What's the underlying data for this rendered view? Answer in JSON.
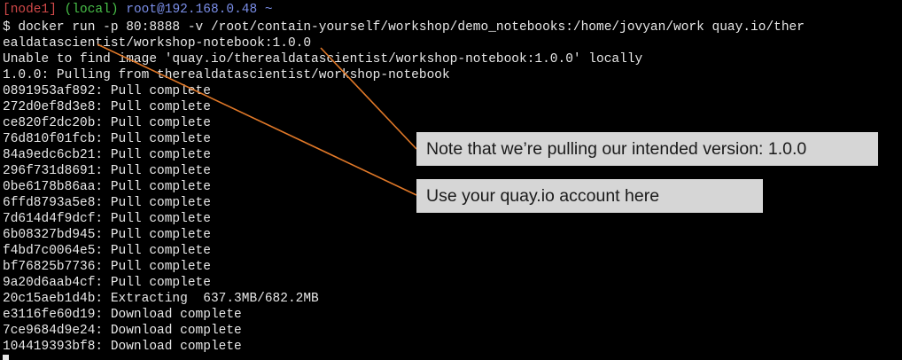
{
  "colors": {
    "background": "#000000",
    "text": "#e8e8e8",
    "prompt_node": "#d04848",
    "prompt_local": "#48c048",
    "prompt_host": "#7a8ee8",
    "callout_bg": "#d6d6d6",
    "arrow": "#e07828"
  },
  "prompt": {
    "node": "[node1]",
    "local": "(local)",
    "host": "root@192.168.0.48 ~"
  },
  "command": {
    "line1": "$ docker run -p 80:8888 -v /root/contain-yourself/workshop/demo_notebooks:/home/jovyan/work quay.io/ther",
    "line2": "ealdatascientist/workshop-notebook:1.0.0"
  },
  "output": [
    "Unable to find image 'quay.io/therealdatascientist/workshop-notebook:1.0.0' locally",
    "1.0.0: Pulling from therealdatascientist/workshop-notebook",
    "0891953af892: Pull complete",
    "272d0ef8d3e8: Pull complete",
    "ce820f2dc20b: Pull complete",
    "76d810f01fcb: Pull complete",
    "84a9edc6cb21: Pull complete",
    "296f731d8691: Pull complete",
    "0be6178b86aa: Pull complete",
    "6ffd8793a5e8: Pull complete",
    "7d614d4f9dcf: Pull complete",
    "6b08327bd945: Pull complete",
    "f4bd7c0064e5: Pull complete",
    "bf76825b7736: Pull complete",
    "9a20d6aab4cf: Pull complete",
    "20c15aeb1d4b: Extracting  637.3MB/682.2MB",
    "e3116fe60d19: Download complete",
    "7ce9684d9e24: Download complete",
    "104419393bf8: Download complete"
  ],
  "callouts": {
    "version_note": "Note that we’re pulling our intended version: 1.0.0",
    "account_note": "Use your quay.io account here"
  }
}
